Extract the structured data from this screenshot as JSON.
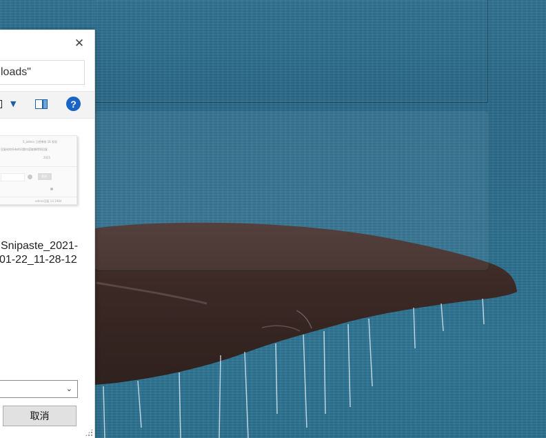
{
  "dialog": {
    "search_text": "loads\"",
    "close_label": "✕",
    "help_label": "?",
    "dropdown_arrow": "▼",
    "file": {
      "name_line1": "Snipaste_2021-",
      "name_line2": "01-22_11-28-12"
    },
    "thumbnail_text": {
      "line1": "5_admin  已经审核  18  发现",
      "line2": "回复给你所有的问题内容能够得到回复",
      "line3": "2021",
      "button": "发送",
      "footer": "admin回复  14  1984"
    },
    "select_chevron": "⌄",
    "cancel_button": "取消"
  },
  "background": {
    "colors": {
      "water": "#2c6f8d",
      "tail": "#3e2b27",
      "dialog_bg": "#ffffff",
      "toolbar_bg": "#f3f3f3",
      "help_blue": "#1a64c6"
    }
  }
}
